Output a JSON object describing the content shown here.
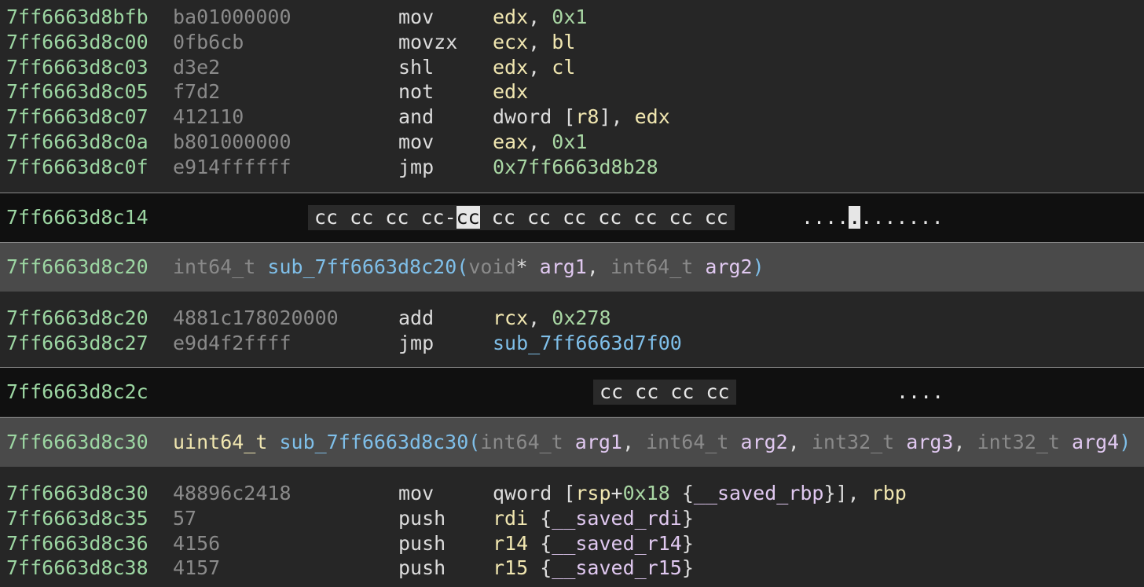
{
  "block1": [
    {
      "addr": "7ff6663d8bfb",
      "bytes": "ba01000000",
      "mn": "mov",
      "op": [
        {
          "t": "edx",
          "c": "reg"
        },
        {
          "t": ", ",
          "c": "plain"
        },
        {
          "t": "0x1",
          "c": "num"
        }
      ]
    },
    {
      "addr": "7ff6663d8c00",
      "bytes": "0fb6cb",
      "mn": "movzx",
      "op": [
        {
          "t": "ecx",
          "c": "reg"
        },
        {
          "t": ", ",
          "c": "plain"
        },
        {
          "t": "bl",
          "c": "reg"
        }
      ]
    },
    {
      "addr": "7ff6663d8c03",
      "bytes": "d3e2",
      "mn": "shl",
      "op": [
        {
          "t": "edx",
          "c": "reg"
        },
        {
          "t": ", ",
          "c": "plain"
        },
        {
          "t": "cl",
          "c": "reg"
        }
      ]
    },
    {
      "addr": "7ff6663d8c05",
      "bytes": "f7d2",
      "mn": "not",
      "op": [
        {
          "t": "edx",
          "c": "reg"
        }
      ]
    },
    {
      "addr": "7ff6663d8c07",
      "bytes": "412110",
      "mn": "and",
      "op": [
        {
          "t": "dword [",
          "c": "plain"
        },
        {
          "t": "r8",
          "c": "reg"
        },
        {
          "t": "], ",
          "c": "plain"
        },
        {
          "t": "edx",
          "c": "reg"
        }
      ]
    },
    {
      "addr": "7ff6663d8c0a",
      "bytes": "b801000000",
      "mn": "mov",
      "op": [
        {
          "t": "eax",
          "c": "reg"
        },
        {
          "t": ", ",
          "c": "plain"
        },
        {
          "t": "0x1",
          "c": "num"
        }
      ]
    },
    {
      "addr": "7ff6663d8c0f",
      "bytes": "e914ffffff",
      "mn": "jmp",
      "op": [
        {
          "t": "0x7ff6663d8b28",
          "c": "num"
        }
      ]
    }
  ],
  "gap1": {
    "addr": "7ff6663d8c14",
    "hex_before": "cc cc cc cc-",
    "hex_selected": "cc",
    "hex_after": " cc cc cc cc cc cc cc",
    "ascii_before": "....",
    "ascii_selected": ".",
    "ascii_after": "......."
  },
  "func1": {
    "addr": "7ff6663d8c20",
    "sig": [
      {
        "t": "int64_t ",
        "c": "type"
      },
      {
        "t": "sub_7ff6663d8c20",
        "c": "sym"
      },
      {
        "t": "(",
        "c": "sym"
      },
      {
        "t": "void",
        "c": "type"
      },
      {
        "t": "* ",
        "c": "plain"
      },
      {
        "t": "arg1",
        "c": "var"
      },
      {
        "t": ", ",
        "c": "plain"
      },
      {
        "t": "int64_t ",
        "c": "type"
      },
      {
        "t": "arg2",
        "c": "var"
      },
      {
        "t": ")",
        "c": "sym"
      }
    ]
  },
  "block2": [
    {
      "addr": "7ff6663d8c20",
      "bytes": "4881c178020000",
      "mn": "add",
      "op": [
        {
          "t": "rcx",
          "c": "reg"
        },
        {
          "t": ", ",
          "c": "plain"
        },
        {
          "t": "0x278",
          "c": "num"
        }
      ]
    },
    {
      "addr": "7ff6663d8c27",
      "bytes": "e9d4f2ffff",
      "mn": "jmp",
      "op": [
        {
          "t": "sub_7ff6663d7f00",
          "c": "sym"
        }
      ]
    }
  ],
  "gap2": {
    "addr": "7ff6663d8c2c",
    "hex": "cc cc cc cc",
    "ascii": "...."
  },
  "func2": {
    "addr": "7ff6663d8c30",
    "sig": [
      {
        "t": "uint64_t ",
        "c": "rettype"
      },
      {
        "t": "sub_7ff6663d8c30",
        "c": "sym"
      },
      {
        "t": "(",
        "c": "sym"
      },
      {
        "t": "int64_t ",
        "c": "type"
      },
      {
        "t": "arg1",
        "c": "var"
      },
      {
        "t": ", ",
        "c": "plain"
      },
      {
        "t": "int64_t ",
        "c": "type"
      },
      {
        "t": "arg2",
        "c": "var"
      },
      {
        "t": ", ",
        "c": "plain"
      },
      {
        "t": "int32_t ",
        "c": "type"
      },
      {
        "t": "arg3",
        "c": "var"
      },
      {
        "t": ", ",
        "c": "plain"
      },
      {
        "t": "int32_t ",
        "c": "type"
      },
      {
        "t": "arg4",
        "c": "var"
      },
      {
        "t": ")",
        "c": "sym"
      }
    ]
  },
  "block3": [
    {
      "addr": "7ff6663d8c30",
      "bytes": "48896c2418",
      "mn": "mov",
      "op": [
        {
          "t": "qword [",
          "c": "plain"
        },
        {
          "t": "rsp",
          "c": "reg"
        },
        {
          "t": "+",
          "c": "plain"
        },
        {
          "t": "0x18",
          "c": "num"
        },
        {
          "t": " {",
          "c": "plain"
        },
        {
          "t": "__saved_rbp",
          "c": "var"
        },
        {
          "t": "}], ",
          "c": "plain"
        },
        {
          "t": "rbp",
          "c": "reg"
        }
      ]
    },
    {
      "addr": "7ff6663d8c35",
      "bytes": "57",
      "mn": "push",
      "op": [
        {
          "t": "rdi",
          "c": "reg"
        },
        {
          "t": " {",
          "c": "plain"
        },
        {
          "t": "__saved_rdi",
          "c": "var"
        },
        {
          "t": "}",
          "c": "plain"
        }
      ]
    },
    {
      "addr": "7ff6663d8c36",
      "bytes": "4156",
      "mn": "push",
      "op": [
        {
          "t": "r14",
          "c": "reg"
        },
        {
          "t": " {",
          "c": "plain"
        },
        {
          "t": "__saved_r14",
          "c": "var"
        },
        {
          "t": "}",
          "c": "plain"
        }
      ]
    },
    {
      "addr": "7ff6663d8c38",
      "bytes": "4157",
      "mn": "push",
      "op": [
        {
          "t": "r15",
          "c": "reg"
        },
        {
          "t": " {",
          "c": "plain"
        },
        {
          "t": "__saved_r15",
          "c": "var"
        },
        {
          "t": "}",
          "c": "plain"
        }
      ]
    }
  ]
}
